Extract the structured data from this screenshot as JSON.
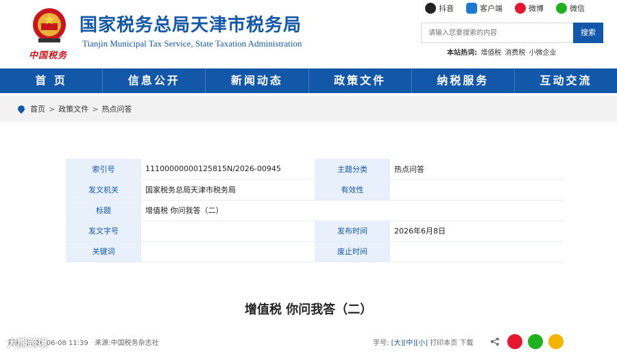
{
  "header": {
    "title": "国家税务总局天津市税务局",
    "subtitle": "Tianjin Municipal Tax Service, State Taxation Administration",
    "slogan": "中国税务"
  },
  "social": [
    {
      "label": "抖音",
      "icon": "douyin-icon"
    },
    {
      "label": "客户端",
      "icon": "client-icon"
    },
    {
      "label": "微博",
      "icon": "weibo-icon"
    },
    {
      "label": "微信",
      "icon": "weixin-icon"
    }
  ],
  "search": {
    "placeholder": "请输入您要搜索的内容",
    "button": "搜索",
    "hot_label": "本站热词:",
    "hot_words": [
      "增值税",
      "消费税",
      "小微企业"
    ]
  },
  "nav": [
    "首 页",
    "信息公开",
    "新闻动态",
    "政策文件",
    "纳税服务",
    "互动交流"
  ],
  "breadcrumb": {
    "items": [
      "首页",
      "政策文件",
      "热点问答"
    ],
    "separator": ">"
  },
  "meta": {
    "index_label": "索引号",
    "index_value": "11100000000125815N/2026-00945",
    "topic_label": "主题分类",
    "topic_value": "热点问答",
    "issuer_label": "发文机关",
    "issuer_value": "国家税务总局天津市税务局",
    "validity_label": "有效性",
    "validity_value": "",
    "title_label": "标题",
    "title_value": "增值税 你问我答（二）",
    "docno_label": "发文字号",
    "docno_value": "",
    "pubtime_label": "发布时间",
    "pubtime_value": "2026年6月8日",
    "keywords_label": "关键词",
    "keywords_value": "",
    "expire_label": "废止时间",
    "expire_value": ""
  },
  "article": {
    "title": "增值税 你问我答（二）",
    "time_label": "时间:",
    "time_value": "2026-06-08 11:39",
    "source_label": "来源:",
    "source_value": "中国税务杂志社",
    "font_label": "字号:",
    "font_big": "[大]",
    "font_mid": "[中]",
    "font_small": "[小]",
    "print": "打印本页",
    "download": "下载"
  },
  "watermark": "大熊跨境",
  "colors": {
    "brand_blue": "#1257a8",
    "label_bg": "#e8f1fb",
    "crumb_bg": "#f2f2f2"
  }
}
